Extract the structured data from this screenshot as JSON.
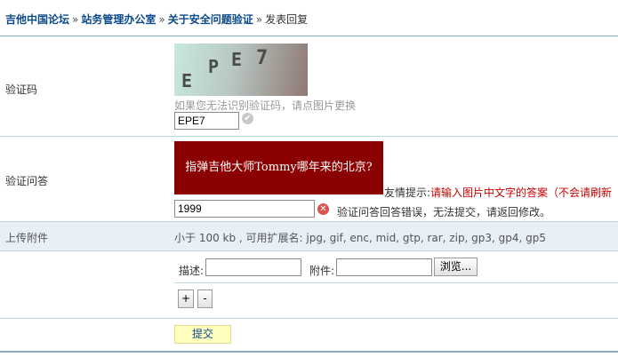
{
  "breadcrumb": {
    "items": [
      "吉他中国论坛",
      "站务管理办公室",
      "关于安全问题验证"
    ],
    "separator": "»",
    "current": "发表回复"
  },
  "captcha": {
    "label": "验证码",
    "image_chars": [
      "E",
      "P",
      "E",
      "7"
    ],
    "hint": "如果您无法识别验证码，请点图片更换",
    "value": "EPE7"
  },
  "question": {
    "label": "验证问答",
    "image_text": "指弹吉他大师Tommy哪年来的北京?",
    "tip_label": "友情提示:",
    "tip_text": "请输入图片中文字的答案（不会请刷新",
    "value": "1999",
    "error_text": "验证问答回答错误，无法提交，请返回修改。"
  },
  "upload": {
    "label": "上传附件",
    "hint": "小于 100 kb , 可用扩展名: jpg, gif, enc, mid, gtp, rar, zip, gp3, gp4, gp5"
  },
  "attachment": {
    "desc_label": "描述:",
    "desc_value": "",
    "file_label": "附件:",
    "file_value": "",
    "browse_label": "浏览...",
    "add_label": "+",
    "remove_label": "-"
  },
  "submit_label": "提交",
  "colors": {
    "link": "#0b4a8a",
    "question_bg": "#8b0000",
    "tip_red": "#cc0000",
    "upload_row_bg": "#e8f0f7",
    "submit_bg": "#ffffc0"
  }
}
